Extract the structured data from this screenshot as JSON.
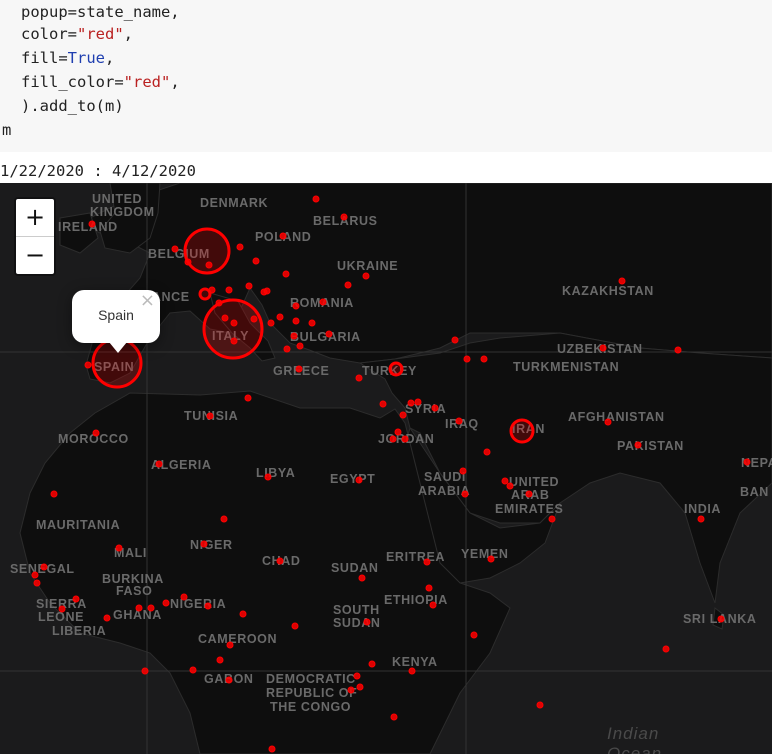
{
  "code": {
    "line1": "popup=state_name,",
    "line2_prefix": "color=",
    "line2_str": "\"red\"",
    "line2_suffix": ",",
    "line3_prefix": "fill=",
    "line3_kw": "True",
    "line3_suffix": ",",
    "line4_prefix": "fill_color=",
    "line4_str": "\"red\"",
    "line4_suffix": ",",
    "line5": ").add_to(m)",
    "line6": "m"
  },
  "output": {
    "date_range": "1/22/2020 : 4/12/2020"
  },
  "map": {
    "zoom_in": "+",
    "zoom_out": "−",
    "popup_text": "Spain",
    "popup_close": "×",
    "marker_color": "#ff0000",
    "labels": {
      "denmark": "DENMARK",
      "united": "UNITED",
      "kingdom": "KINGDOM",
      "ireland": "IRELAND",
      "belarus": "BELARUS",
      "poland": "POLAND",
      "belgium": "BELGIUM",
      "ukraine": "UKRAINE",
      "france": "FRANCE",
      "romania": "ROMANIA",
      "kazakhstan": "KAZAKHSTAN",
      "italy": "ITALY",
      "bulgaria": "BULGARIA",
      "spain": "SPAIN",
      "uzbekistan": "UZBEKISTAN",
      "turkmenistan": "TURKMENISTAN",
      "turkey": "TURKEY",
      "greece": "GREECE",
      "tunisia": "TUNISIA",
      "syria": "SYRIA",
      "iraq": "IRAQ",
      "jordan": "JORDAN",
      "iran": "IRAN",
      "afghanistan": "AFGHANISTAN",
      "morocco": "MOROCCO",
      "pakistan": "PAKISTAN",
      "algeria": "ALGERIA",
      "libya": "LIBYA",
      "egypt": "EGYPT",
      "saudi": "SAUDI",
      "arabia": "ARABIA",
      "united2": "UNITED",
      "arab": "ARAB",
      "emirates": "EMIRATES",
      "nepal": "NEPAL",
      "ban": "BAN",
      "india": "INDIA",
      "mauritania": "MAURITANIA",
      "mali": "MALI",
      "niger": "NIGER",
      "chad": "CHAD",
      "sudan": "SUDAN",
      "eritrea": "ERITREA",
      "yemen": "YEMEN",
      "senegal": "SENEGAL",
      "burkina": "BURKINA",
      "faso": "FASO",
      "sierra": "SIERRA",
      "leone": "LEONE",
      "liberia": "LIBERIA",
      "ghana": "GHANA",
      "nigeria": "NIGERIA",
      "ethiopia": "ETHIOPIA",
      "south": "SOUTH",
      "sudan2": "SUDAN",
      "srilanka": "SRI LANKA",
      "cameroon": "CAMEROON",
      "kenya": "KENYA",
      "gabon": "GABON",
      "democratic": "DEMOCRATIC",
      "republic": "REPUBLIC OF",
      "thecongo": "THE CONGO",
      "indian": "Indian",
      "ocean": "Ocean"
    }
  }
}
